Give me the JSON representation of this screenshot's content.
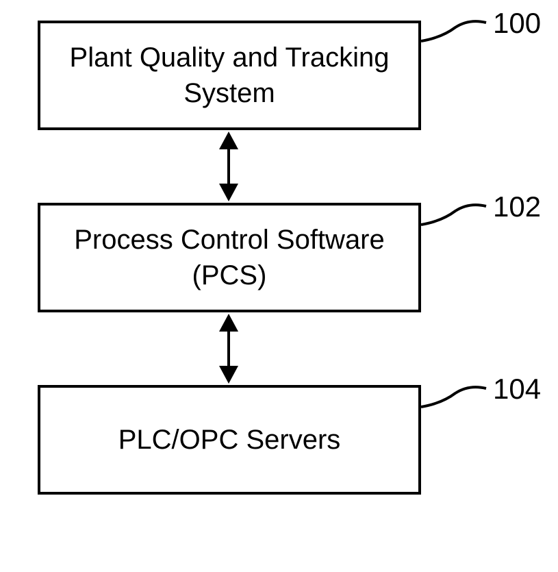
{
  "boxes": {
    "top": {
      "line1": "Plant Quality and Tracking",
      "line2": "System",
      "ref": "100"
    },
    "middle": {
      "line1": "Process Control Software",
      "line2": "(PCS)",
      "ref": "102"
    },
    "bottom": {
      "line1": "PLC/OPC Servers",
      "ref": "104"
    }
  }
}
